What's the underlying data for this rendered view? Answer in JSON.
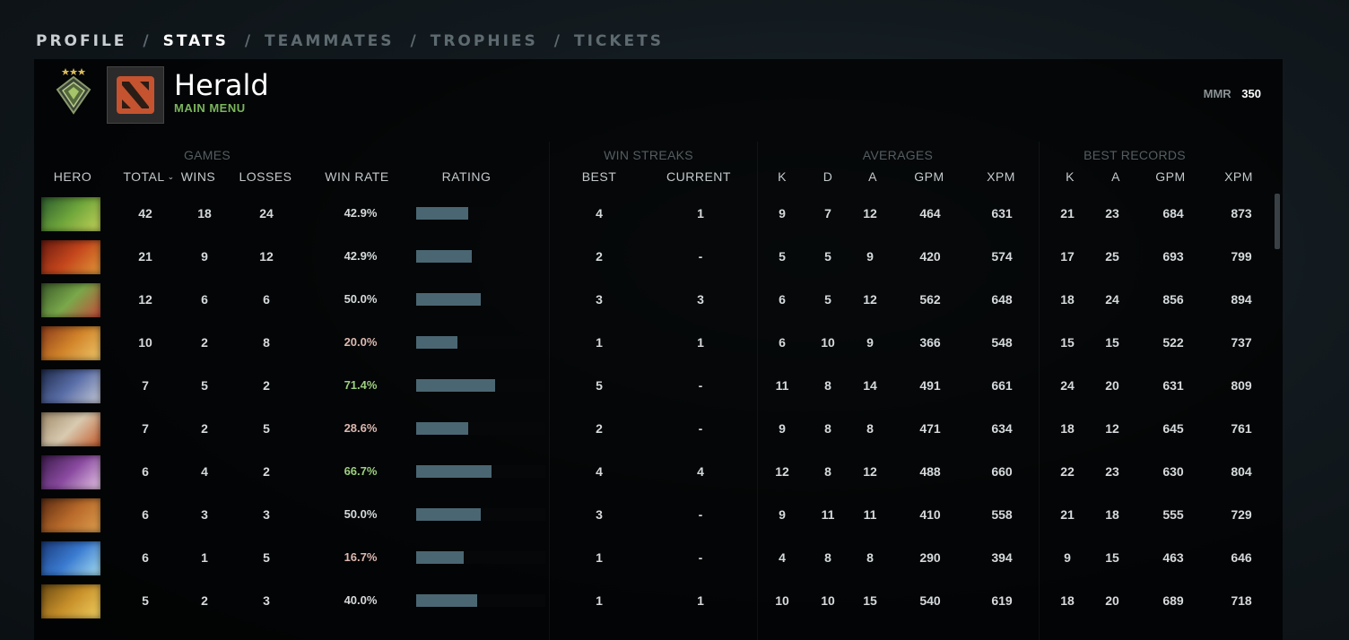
{
  "nav": {
    "items": [
      "PROFILE",
      "STATS",
      "TEAMMATES",
      "TROPHIES",
      "TICKETS"
    ],
    "separator": "/",
    "active": "STATS"
  },
  "profile": {
    "name": "Herald",
    "status": "MAIN MENU",
    "mmr_label": "MMR",
    "mmr_value": "350"
  },
  "table": {
    "groups": {
      "games": "GAMES",
      "win_streaks": "WIN STREAKS",
      "averages": "AVERAGES",
      "best_records": "BEST RECORDS"
    },
    "columns": {
      "hero": "HERO",
      "total": "TOTAL",
      "wins": "WINS",
      "losses": "LOSSES",
      "win_rate": "WIN RATE",
      "rating": "RATING",
      "best": "BEST",
      "current": "CURRENT",
      "avg_k": "K",
      "avg_d": "D",
      "avg_a": "A",
      "avg_gpm": "GPM",
      "avg_xpm": "XPM",
      "best_k": "K",
      "best_a": "A",
      "best_gpm": "GPM",
      "best_xpm": "XPM"
    },
    "colors": {
      "win_rate_high": "#9ccf7e",
      "win_rate_low": "#dcb8b0",
      "win_rate_neutral": "#d6dadc",
      "rating_bar": "#4a6672"
    },
    "rows": [
      {
        "hero": "hero-green",
        "total": "42",
        "wins": "18",
        "losses": "24",
        "win_rate": "42.9%",
        "rating": 0.4,
        "best": "4",
        "current": "1",
        "avg_k": "9",
        "avg_d": "7",
        "avg_a": "12",
        "avg_gpm": "464",
        "avg_xpm": "631",
        "best_k": "21",
        "best_a": "23",
        "best_gpm": "684",
        "best_xpm": "873"
      },
      {
        "hero": "hero-red",
        "total": "21",
        "wins": "9",
        "losses": "12",
        "win_rate": "42.9%",
        "rating": 0.43,
        "best": "2",
        "current": "-",
        "avg_k": "5",
        "avg_d": "5",
        "avg_a": "9",
        "avg_gpm": "420",
        "avg_xpm": "574",
        "best_k": "17",
        "best_a": "25",
        "best_gpm": "693",
        "best_xpm": "799"
      },
      {
        "hero": "hero-green-red",
        "total": "12",
        "wins": "6",
        "losses": "6",
        "win_rate": "50.0%",
        "rating": 0.5,
        "best": "3",
        "current": "3",
        "avg_k": "6",
        "avg_d": "5",
        "avg_a": "12",
        "avg_gpm": "562",
        "avg_xpm": "648",
        "best_k": "18",
        "best_a": "24",
        "best_gpm": "856",
        "best_xpm": "894"
      },
      {
        "hero": "hero-gold-red",
        "total": "10",
        "wins": "2",
        "losses": "8",
        "win_rate": "20.0%",
        "rating": 0.32,
        "best": "1",
        "current": "1",
        "avg_k": "6",
        "avg_d": "10",
        "avg_a": "9",
        "avg_gpm": "366",
        "avg_xpm": "548",
        "best_k": "15",
        "best_a": "15",
        "best_gpm": "522",
        "best_xpm": "737"
      },
      {
        "hero": "hero-blue-silver",
        "total": "7",
        "wins": "5",
        "losses": "2",
        "win_rate": "71.4%",
        "rating": 0.61,
        "best": "5",
        "current": "-",
        "avg_k": "11",
        "avg_d": "8",
        "avg_a": "14",
        "avg_gpm": "491",
        "avg_xpm": "661",
        "best_k": "24",
        "best_a": "20",
        "best_gpm": "631",
        "best_xpm": "809"
      },
      {
        "hero": "hero-pale-orange",
        "total": "7",
        "wins": "2",
        "losses": "5",
        "win_rate": "28.6%",
        "rating": 0.4,
        "best": "2",
        "current": "-",
        "avg_k": "9",
        "avg_d": "8",
        "avg_a": "8",
        "avg_gpm": "471",
        "avg_xpm": "634",
        "best_k": "18",
        "best_a": "12",
        "best_gpm": "645",
        "best_xpm": "761"
      },
      {
        "hero": "hero-purple",
        "total": "6",
        "wins": "4",
        "losses": "2",
        "win_rate": "66.7%",
        "rating": 0.58,
        "best": "4",
        "current": "4",
        "avg_k": "12",
        "avg_d": "8",
        "avg_a": "12",
        "avg_gpm": "488",
        "avg_xpm": "660",
        "best_k": "22",
        "best_a": "23",
        "best_gpm": "630",
        "best_xpm": "804"
      },
      {
        "hero": "hero-bronze",
        "total": "6",
        "wins": "3",
        "losses": "3",
        "win_rate": "50.0%",
        "rating": 0.5,
        "best": "3",
        "current": "-",
        "avg_k": "9",
        "avg_d": "11",
        "avg_a": "11",
        "avg_gpm": "410",
        "avg_xpm": "558",
        "best_k": "21",
        "best_a": "18",
        "best_gpm": "555",
        "best_xpm": "729"
      },
      {
        "hero": "hero-blue-water",
        "total": "6",
        "wins": "1",
        "losses": "5",
        "win_rate": "16.7%",
        "rating": 0.37,
        "best": "1",
        "current": "-",
        "avg_k": "4",
        "avg_d": "8",
        "avg_a": "8",
        "avg_gpm": "290",
        "avg_xpm": "394",
        "best_k": "9",
        "best_a": "15",
        "best_gpm": "463",
        "best_xpm": "646"
      },
      {
        "hero": "hero-yellow",
        "total": "5",
        "wins": "2",
        "losses": "3",
        "win_rate": "40.0%",
        "rating": 0.47,
        "best": "1",
        "current": "1",
        "avg_k": "10",
        "avg_d": "10",
        "avg_a": "15",
        "avg_gpm": "540",
        "avg_xpm": "619",
        "best_k": "18",
        "best_a": "20",
        "best_gpm": "689",
        "best_xpm": "718"
      }
    ]
  }
}
